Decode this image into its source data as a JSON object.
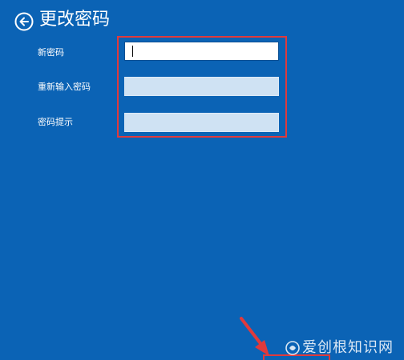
{
  "header": {
    "title": "更改密码",
    "back_icon": "arrow-left-circle-icon"
  },
  "form": {
    "fields": [
      {
        "label": "新密码",
        "value": "",
        "state": "focused"
      },
      {
        "label": "重新输入密码",
        "value": "",
        "state": "inactive"
      },
      {
        "label": "密码提示",
        "value": "",
        "state": "inactive"
      }
    ]
  },
  "watermark": {
    "text": "爱创根知识网"
  },
  "colors": {
    "background": "#0b63b5",
    "highlight": "#e03a3c",
    "field_inactive": "#cfe2f3",
    "field_active": "#ffffff"
  }
}
